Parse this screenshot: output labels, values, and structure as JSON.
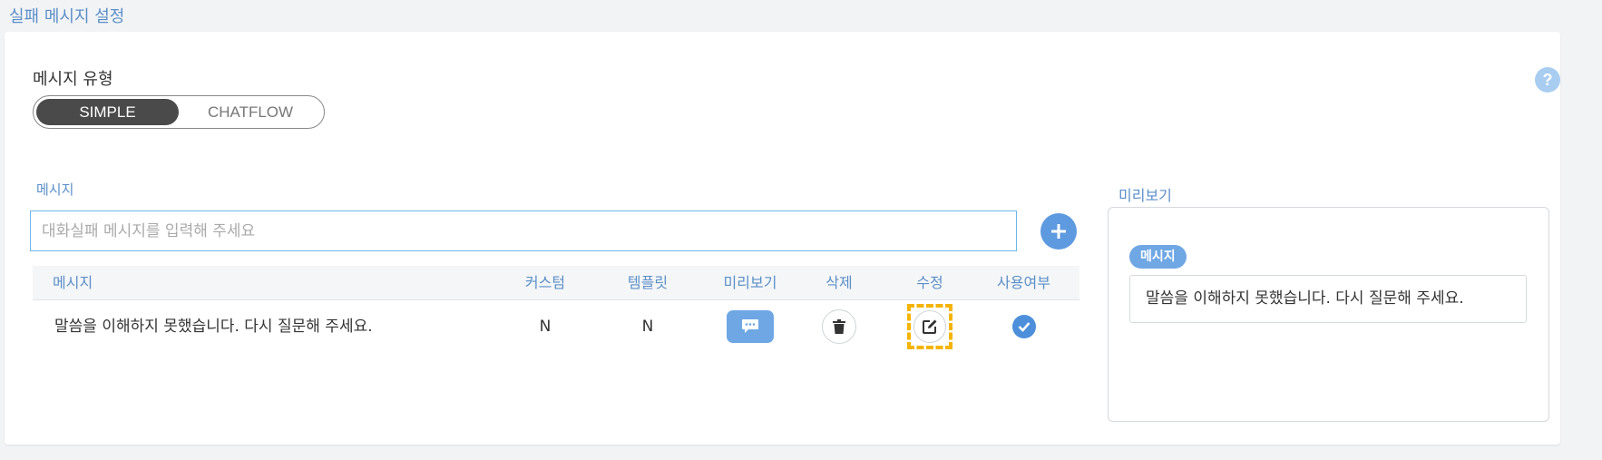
{
  "page": {
    "title": "실패 메시지 설정"
  },
  "help": {
    "icon": "help-circle-icon",
    "glyph": "?"
  },
  "message_type": {
    "label": "메시지 유형",
    "options": [
      "SIMPLE",
      "CHATFLOW"
    ],
    "selected": "SIMPLE"
  },
  "message_input": {
    "label": "메시지",
    "placeholder": "대화실패 메시지를 입력해 주세요",
    "value": ""
  },
  "add_button": {
    "icon": "plus-icon"
  },
  "table": {
    "headers": [
      "메시지",
      "커스텀",
      "템플릿",
      "미리보기",
      "삭제",
      "수정",
      "사용여부"
    ],
    "rows": [
      {
        "message": "말씀을 이해하지 못했습니다. 다시 질문해 주세요.",
        "custom": "N",
        "template": "N",
        "preview_icon": "chat-bubble-icon",
        "delete_icon": "trash-icon",
        "edit_icon": "edit-icon",
        "enabled": true,
        "enabled_icon": "check-circle-icon"
      }
    ]
  },
  "preview": {
    "label": "미리보기",
    "badge": "메시지",
    "message": "말씀을 이해하지 못했습니다. 다시 질문해 주세요."
  },
  "colors": {
    "accent": "#5b8fc9",
    "button_blue": "#5d9ae0",
    "highlight": "#f5b400",
    "toggle_active": "#4a4a4a"
  }
}
